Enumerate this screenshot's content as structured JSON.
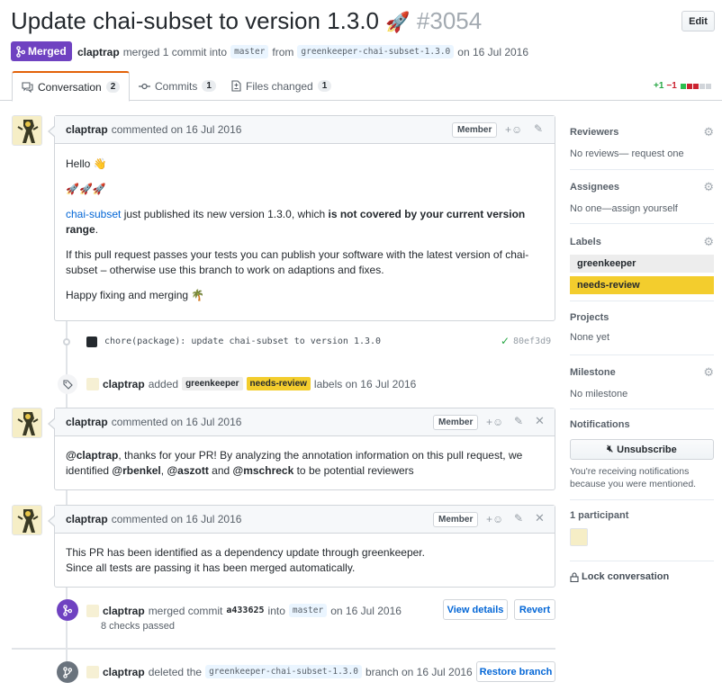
{
  "pr": {
    "title": "Update chai-subset to version 1.3.0",
    "title_emoji": "🚀",
    "number": "#3054",
    "edit_label": "Edit",
    "state": "Merged",
    "state_icon": "merge-icon",
    "meta_author": "claptrap",
    "meta_text1": "merged 1 commit into",
    "meta_base": "master",
    "meta_text2": "from",
    "meta_head": "greenkeeper-chai-subset-1.3.0",
    "meta_text3": "on 16 Jul 2016"
  },
  "tabs": [
    {
      "label": "Conversation",
      "count": "2",
      "icon": "comment-icon"
    },
    {
      "label": "Commits",
      "count": "1",
      "icon": "commit-icon"
    },
    {
      "label": "Files changed",
      "count": "1",
      "icon": "file-diff-icon"
    }
  ],
  "diffstat": {
    "additions": "+1",
    "deletions": "−1",
    "colors": [
      "#2cbe4e",
      "#cb2431",
      "#cb2431",
      "#d1d5da",
      "#d1d5da"
    ]
  },
  "comment1": {
    "author": "claptrap",
    "meta": "commented on 16 Jul 2016",
    "role": "Member",
    "hello": "Hello",
    "hello_emoji": "👋",
    "rockets": "🚀🚀🚀",
    "p1_link": "chai-subset",
    "p1_text": " just published its new version 1.3.0, which ",
    "p1_bold": "is not covered by your current version range",
    "p1_end": ".",
    "p2": "If this pull request passes your tests you can publish your software with the latest version of chai-subset – otherwise use this branch to work on adaptions and fixes.",
    "p3": "Happy fixing and merging",
    "p3_emoji": "🌴"
  },
  "commit": {
    "message": "chore(package): update chai-subset to version 1.3.0",
    "sha": "80ef3d9",
    "status": "✓"
  },
  "label_event": {
    "author": "claptrap",
    "action": "added",
    "label1": "greenkeeper",
    "label2": "needs-review",
    "suffix": "labels on 16 Jul 2016"
  },
  "comment2": {
    "author": "claptrap",
    "meta": "commented on 16 Jul 2016",
    "role": "Member",
    "m1": "@claptrap",
    "t1": ", thanks for your PR! By analyzing the annotation information on this pull request, we identified ",
    "m2": "@rbenkel",
    "t2": ", ",
    "m3": "@aszott",
    "t3": " and ",
    "m4": "@mschreck",
    "t4": " to be potential reviewers"
  },
  "comment3": {
    "author": "claptrap",
    "meta": "commented on 16 Jul 2016",
    "role": "Member",
    "line1": "This PR has been identified as a dependency update through greenkeeper.",
    "line2": "Since all tests are passing it has been merged automatically."
  },
  "merge_event": {
    "author": "claptrap",
    "text1": "merged commit",
    "sha": "a433625",
    "text2": "into",
    "branch": "master",
    "text3": "on 16 Jul 2016",
    "checks": "8 checks passed",
    "view_details": "View details",
    "revert": "Revert"
  },
  "delete_event": {
    "author": "claptrap",
    "text1": "deleted the",
    "branch": "greenkeeper-chai-subset-1.3.0",
    "text2": "branch on 16 Jul 2016",
    "restore": "Restore branch"
  },
  "sidebar": {
    "reviewers_h": "Reviewers",
    "reviewers_v": "No reviews— request one",
    "assignees_h": "Assignees",
    "assignees_v": "No one—assign yourself",
    "labels_h": "Labels",
    "labels": [
      {
        "name": "greenkeeper",
        "color": "#ededed"
      },
      {
        "name": "needs-review",
        "color": "#f3cd2d"
      }
    ],
    "projects_h": "Projects",
    "projects_v": "None yet",
    "milestone_h": "Milestone",
    "milestone_v": "No milestone",
    "notifications_h": "Notifications",
    "unsubscribe": "Unsubscribe",
    "notif_text": "You're receiving notifications because you were mentioned.",
    "participants_h": "1 participant",
    "lock": "Lock conversation"
  }
}
